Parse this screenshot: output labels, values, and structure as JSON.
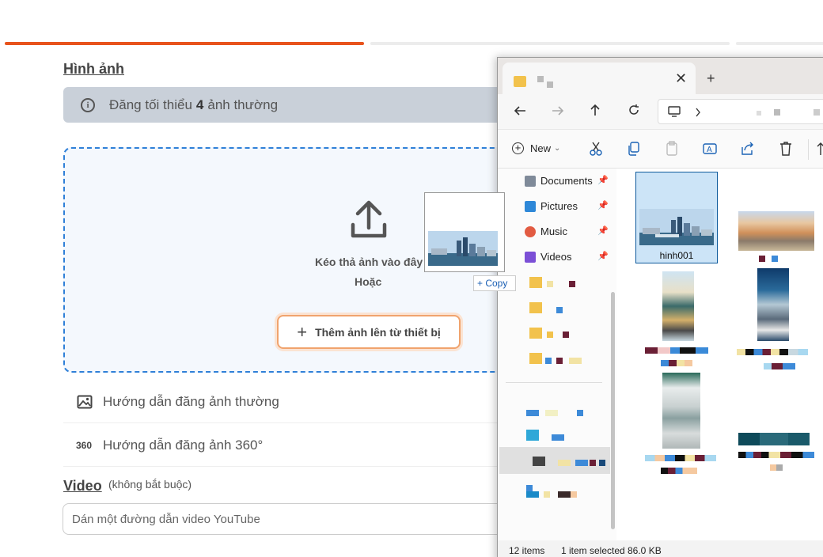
{
  "form": {
    "images_title": "Hình ảnh",
    "info_prefix": "Đăng tối thiểu",
    "info_count": "4",
    "info_suffix": "ảnh thường",
    "drop_text": "Kéo thả ảnh vào đây",
    "or_text": "Hoặc",
    "add_button": "Thêm ảnh lên từ thiết bị",
    "guide_normal": "Hướng dẫn đăng ảnh thường",
    "guide_360_icon": "360",
    "guide_360": "Hướng dẫn đăng ảnh 360°",
    "video_title": "Video",
    "video_optional": "(không bắt buộc)",
    "video_placeholder": "Dán một đường dẫn video YouTube"
  },
  "drag": {
    "copy_label": "+ Copy"
  },
  "explorer": {
    "tab_close": "✕",
    "new_tab": "+",
    "toolbar_new": "New",
    "toolbar_new_chevron": "⌄",
    "nav_items": [
      {
        "label": "Documents",
        "icon": "documents-icon",
        "color": "#7f8a99"
      },
      {
        "label": "Pictures",
        "icon": "pictures-icon",
        "color": "#2e88d8"
      },
      {
        "label": "Music",
        "icon": "music-icon",
        "color": "#e25b42"
      },
      {
        "label": "Videos",
        "icon": "videos-icon",
        "color": "#7b4fd6"
      }
    ],
    "selected_file": "hinh001",
    "status_items": "12 items",
    "status_selected": "1 item selected",
    "status_size": "86.0 KB"
  },
  "colors": {
    "accent": "#e8531c",
    "drop_border": "#2f80d8",
    "selection": "#cce4f7"
  }
}
